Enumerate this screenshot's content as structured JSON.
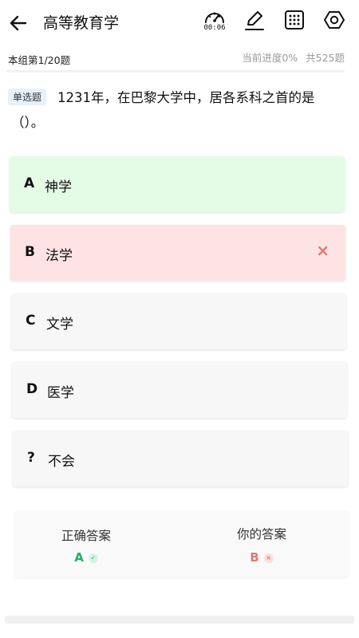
{
  "header": {
    "title": "高等教育学",
    "timer": "00:06",
    "icons": [
      "back-arrow-icon",
      "speedometer-timer-icon",
      "edit-icon",
      "grid-icon",
      "settings-icon"
    ]
  },
  "subheader": {
    "group_label": "本组第1/20题",
    "progress_label": "当前进度0%",
    "total_label": "共525题"
  },
  "question": {
    "type_label": "单选题",
    "text_line1": "1231年，在巴黎大学中，居各系科之首的是",
    "text_line2": "（）。"
  },
  "options": [
    {
      "letter": "A",
      "text": "神学",
      "state": "correct",
      "bg": "#e4fbe6"
    },
    {
      "letter": "B",
      "text": "法学",
      "state": "wrong",
      "bg": "#fde3e3",
      "mark": "×"
    },
    {
      "letter": "C",
      "text": "文学",
      "state": "none",
      "bg": "#f7f7f7"
    },
    {
      "letter": "D",
      "text": "医学",
      "state": "none",
      "bg": "#f7f7f7"
    },
    {
      "letter": "?",
      "text": "不会",
      "state": "none",
      "bg": "#f7f7f7"
    }
  ],
  "answer_card": {
    "correct_label": "正确答案",
    "correct_value": "A",
    "correct_badge": "✓",
    "your_label": "你的答案",
    "your_value": "B",
    "your_badge": "×"
  },
  "colors": {
    "correct": "#1fae6a",
    "wrong": "#e07a6b",
    "correct_badge_bg": "#d7f4e3",
    "wrong_badge_bg": "#fbe0df"
  }
}
